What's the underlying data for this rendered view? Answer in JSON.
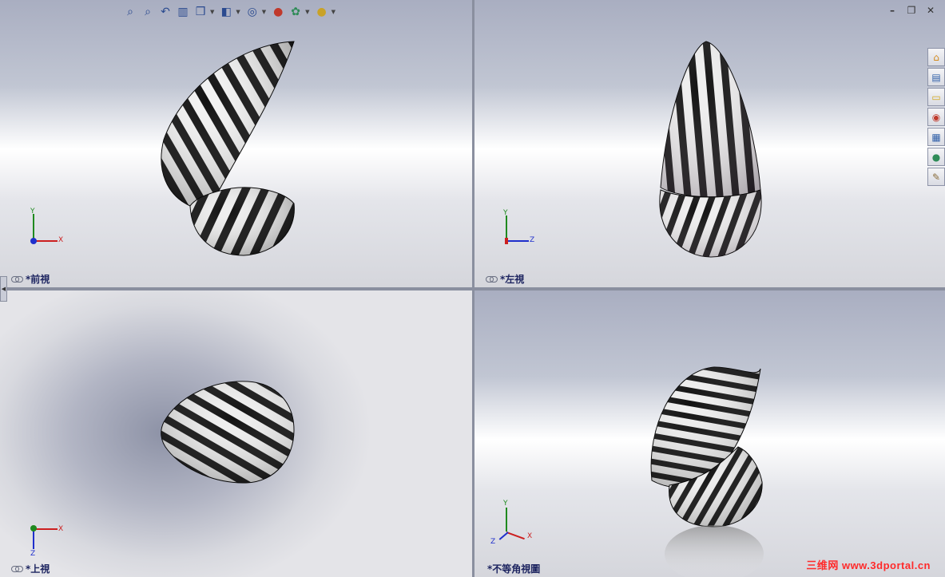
{
  "viewports": {
    "front": {
      "label": "*前視"
    },
    "left": {
      "label": "*左視"
    },
    "top": {
      "label": "*上視"
    },
    "iso": {
      "label": "*不等角視圖"
    }
  },
  "triads": {
    "front": {
      "axis1": "Y",
      "axis2": "X"
    },
    "left": {
      "axis1": "Y",
      "axis2": "Z"
    },
    "top": {
      "axis1": "Z",
      "axis2": "X"
    },
    "iso": {
      "axis1": "Y",
      "axis2": "X",
      "axis3": "Z"
    }
  },
  "heads_up_toolbar": [
    "zoom-to-fit-icon",
    "zoom-to-area-icon",
    "previous-view-icon",
    "section-view-icon",
    "view-orientation-icon",
    "display-style-icon",
    "hide-show-items-icon",
    "edit-appearance-icon",
    "apply-scene-icon",
    "view-settings-icon"
  ],
  "task_pane": [
    "solidworks-resources-icon",
    "design-library-icon",
    "file-explorer-icon",
    "search-icon",
    "view-palette-icon",
    "appearances-icon",
    "custom-properties-icon"
  ],
  "watermark": "三维网 www.3dportal.cn",
  "colors": {
    "triad_x": "#cc1f1f",
    "triad_y": "#1f8a1f",
    "triad_z": "#1f2fcc",
    "label_text": "#1d2460"
  }
}
